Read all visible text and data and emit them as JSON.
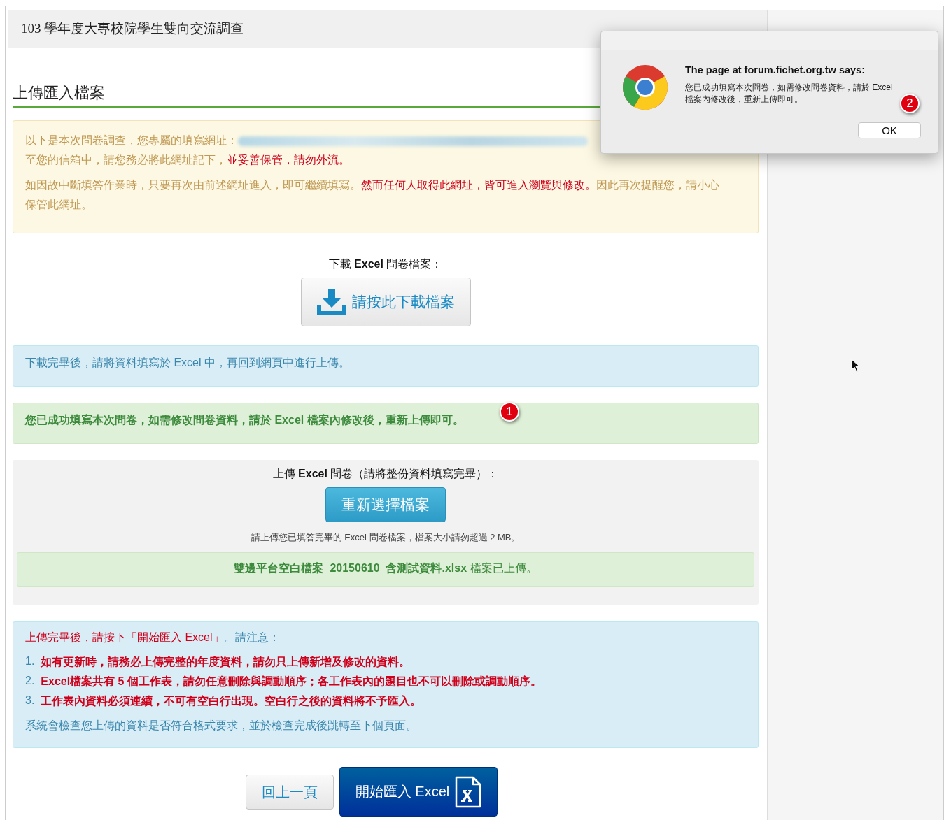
{
  "page_title": "103 學年度大專校院學生雙向交流調查",
  "section_heading": "上傳匯入檔案",
  "notice": {
    "line_1": "以下是本次問卷調查，您專屬的填寫網址：",
    "line_2": "至您的信箱中，請您務必將此網址記下，**並妥善保管，請勿外流。**",
    "paragraph_2": "如因故中斷填答作業時，只要再次由前述網址進入，即可繼續填寫。**然而任何人取得此網址，皆可進入瀏覽與修改。**因此再次提醒您，請小心保管此網址。"
  },
  "download": {
    "label": "下載 **Excel** 問卷檔案：",
    "button": "請按此下載檔案"
  },
  "info_message": "下載完畢後，請將資料填寫於 Excel 中，再回到網頁中進行上傳。",
  "success_message": {
    "text": "您已成功填寫本次問卷，如需修改問卷資料，請於 Excel 檔案內修改後，重新上傳即可。",
    "annotation": "1"
  },
  "upload": {
    "label": "上傳 **Excel** 問卷（請將整份資料填寫完畢）：",
    "button": "重新選擇檔案",
    "hint": "請上傳您已填答完畢的 Excel 問卷檔案，檔案大小請勿超過 2 MB。",
    "uploaded_file": "**雙邊平台空白檔案_20150610_含測試資料.xlsx** 檔案已上傳。"
  },
  "instructions": {
    "heading": "**上傳完畢後，請按下「開始匯入 Excel」**。請注意：",
    "items": [
      {
        "number": "1.",
        "text": "如有更新時，請務必上傳完整的年度資料，請勿只上傳新增及修改的資料。"
      },
      {
        "number": "2.",
        "text": "Excel檔案共有 5 個工作表，請勿任意刪除與調動順序；各工作表內的題目也不可以刪除或調動順序。"
      },
      {
        "number": "3.",
        "text": "工作表內資料必須連續，不可有空白行出現。空白行之後的資料將不予匯入。"
      }
    ],
    "footer": "系統會檢查您上傳的資料是否符合格式要求，並於檢查完成後跳轉至下個頁面。"
  },
  "buttons": [
    {
      "kind": "secondary",
      "label": "回上一頁"
    },
    {
      "kind": "primary",
      "label": "開始匯入 Excel"
    }
  ],
  "dialog": {
    "title": "The page at forum.fichet.org.tw says:",
    "message_lines": [
      "您已成功填寫本次問卷，如需修改問卷資料，請於 Excel",
      "檔案內修改後，重新上傳即可。"
    ],
    "button": "OK",
    "annotation": "2"
  }
}
